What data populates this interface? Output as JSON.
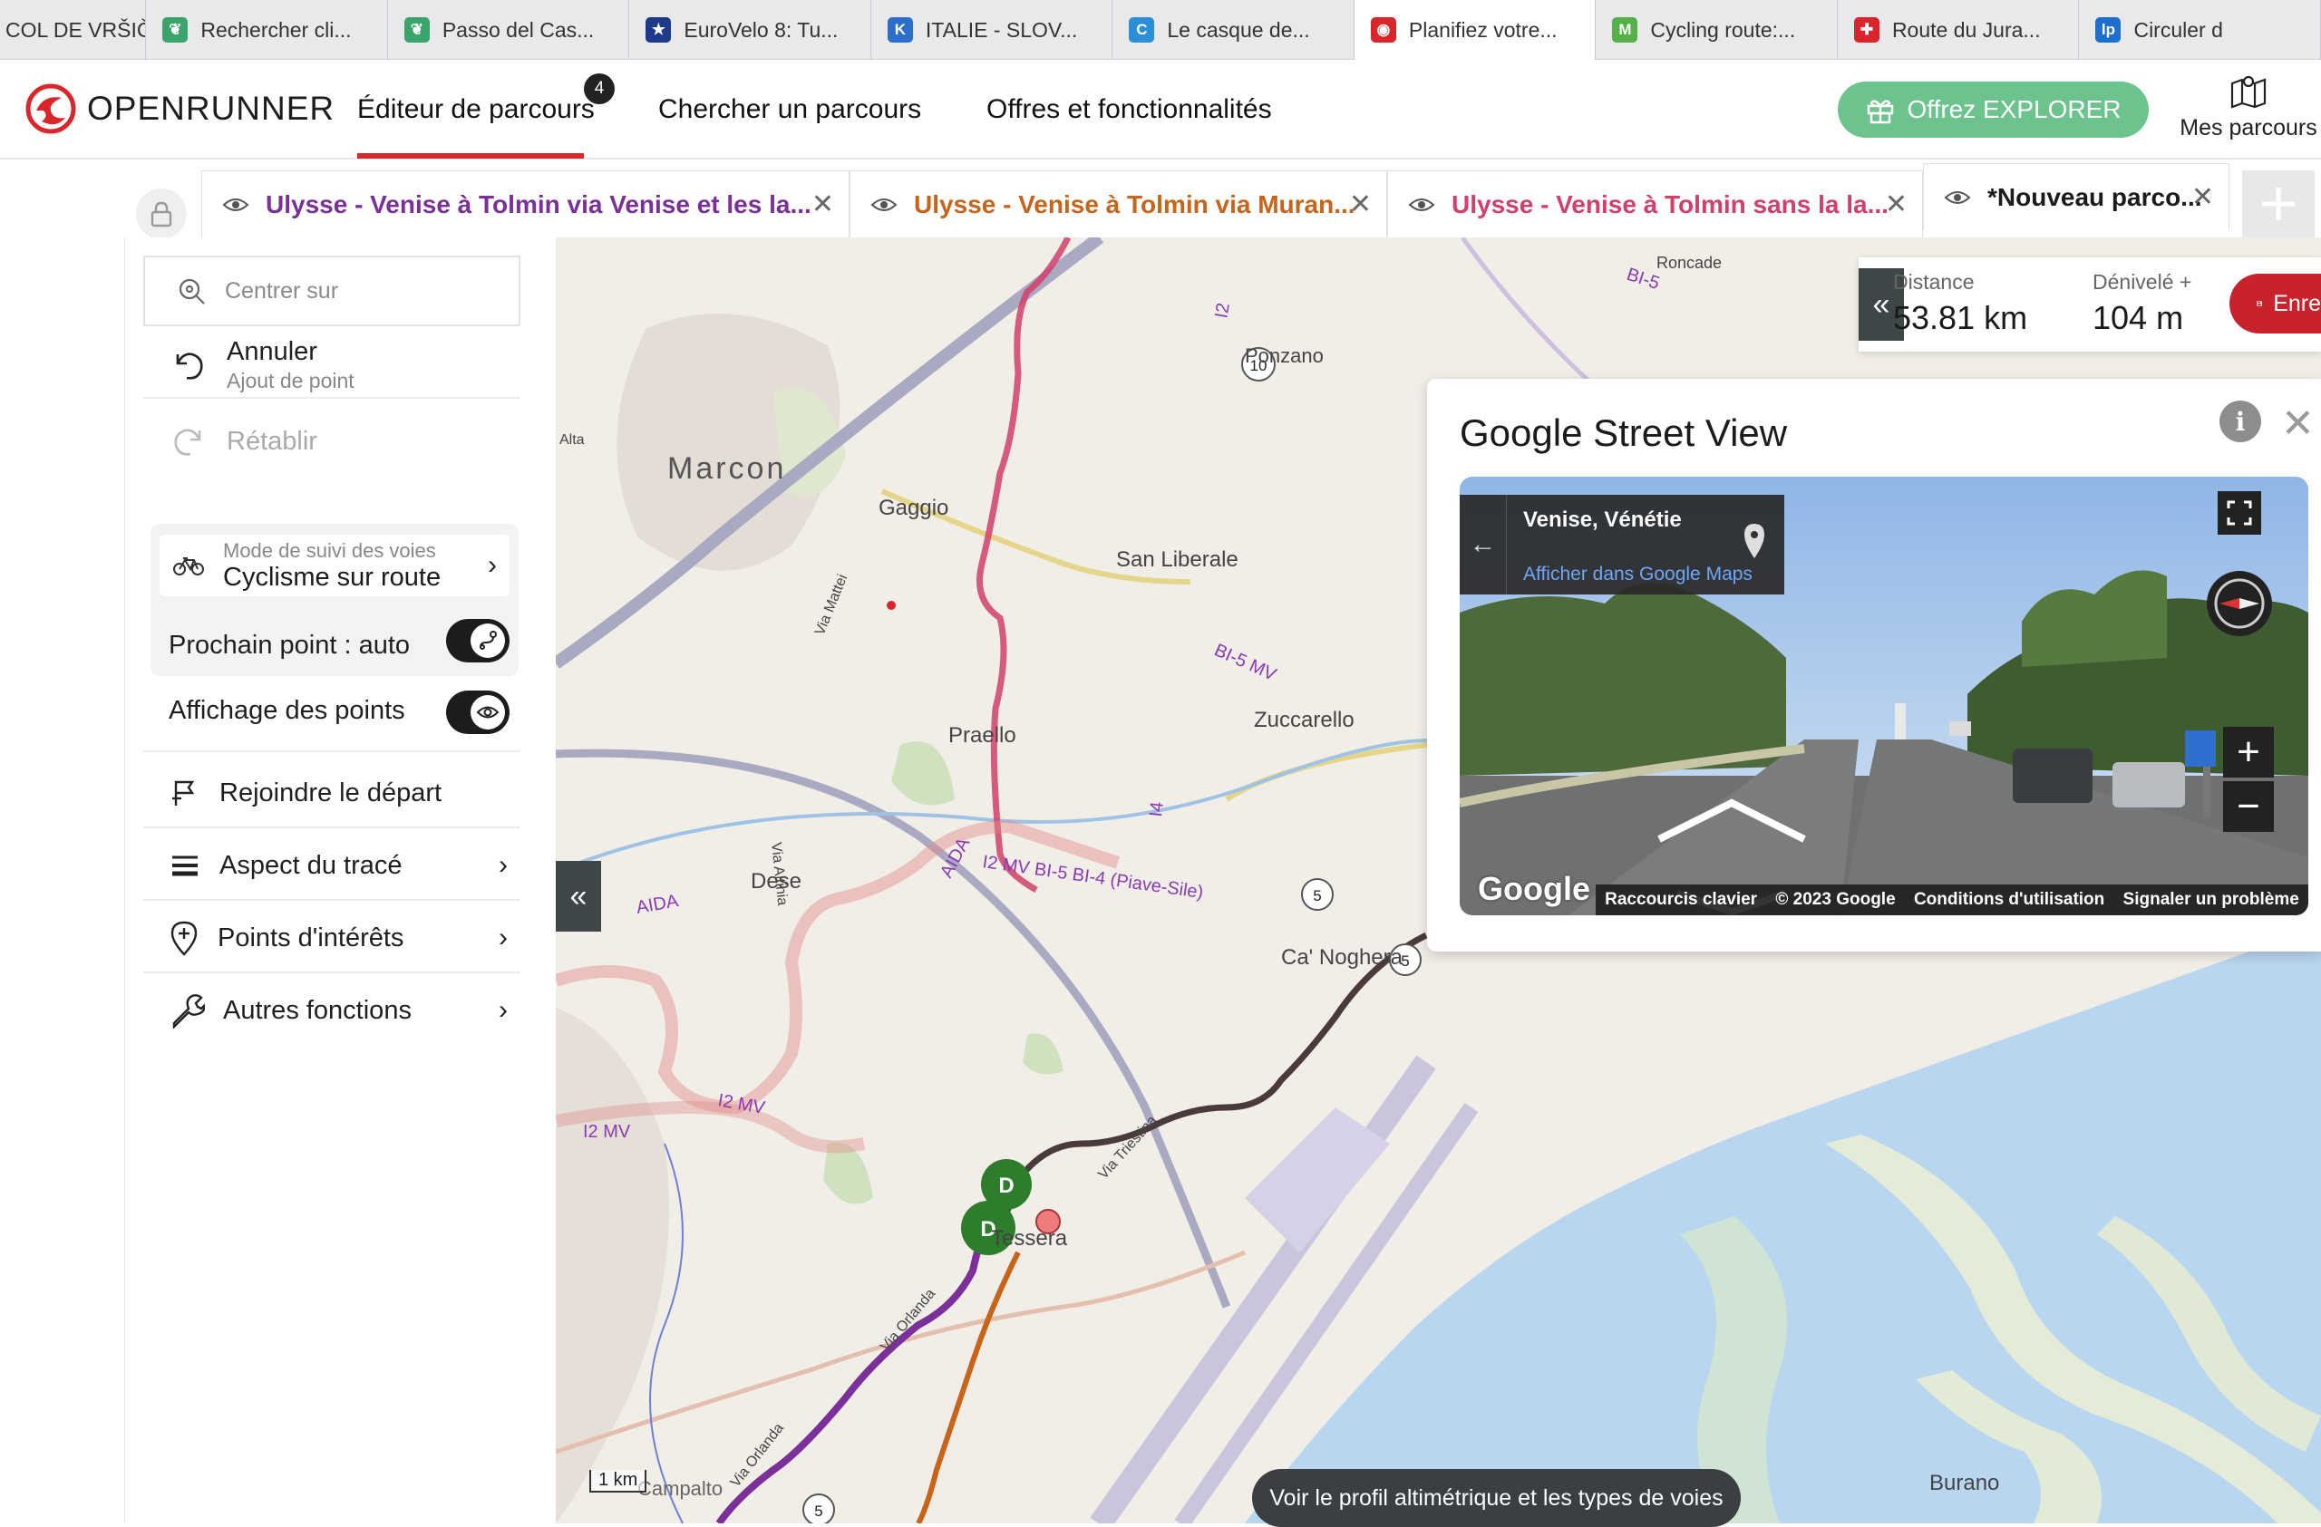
{
  "browser_tabs": [
    {
      "title": "COL DE VRŠIČ...",
      "icon": "none",
      "color": "#ffffff"
    },
    {
      "title": "Rechercher cli...",
      "icon": "leaf-icon",
      "color": "#3aa56a"
    },
    {
      "title": "Passo del Cas...",
      "icon": "leaf-icon",
      "color": "#3aa56a"
    },
    {
      "title": "EuroVelo 8: Tu...",
      "icon": "eurovelo-icon",
      "color": "#1e3a8a"
    },
    {
      "title": "ITALIE - SLOV...",
      "icon": "k-icon",
      "color": "#2a6fc9"
    },
    {
      "title": "Le casque de...",
      "icon": "c-icon",
      "color": "#2a8fd6"
    },
    {
      "title": "Planifiez votre...",
      "icon": "openrunner-icon",
      "color": "#d8262b",
      "active": true
    },
    {
      "title": "Cycling route:...",
      "icon": "m-icon",
      "color": "#55b048"
    },
    {
      "title": "Route du Jura...",
      "icon": "swiss-icon",
      "color": "#d9252c"
    },
    {
      "title": "Circuler d",
      "icon": "lp-icon",
      "color": "#1c6fcf"
    }
  ],
  "header": {
    "logo_text": "OPENRUNNER",
    "nav": {
      "editor": "Éditeur de parcours",
      "editor_badge": "4",
      "search": "Chercher un parcours",
      "offers": "Offres et fonctionnalités"
    },
    "explorer_label": "Offrez EXPLORER",
    "my_routes_label": "Mes parcours"
  },
  "route_tabs": [
    {
      "title": "Ulysse - Venise à Tolmin via Venise et les la...",
      "color": "#7b2f98"
    },
    {
      "title": "Ulysse - Venise à Tolmin via Muran...",
      "color": "#c8631a"
    },
    {
      "title": "Ulysse - Venise à Tolmin sans la la...",
      "color": "#d1406a"
    },
    {
      "title": "*Nouveau parco...",
      "color": "#1b1b1b"
    }
  ],
  "left_panel": {
    "center_placeholder": "Centrer sur",
    "undo_label": "Annuler",
    "undo_sub": "Ajout de point",
    "redo_label": "Rétablir",
    "mode_label": "Mode de suivi des voies",
    "mode_value": "Cyclisme sur route",
    "next_point_label": "Prochain point : auto",
    "show_points_label": "Affichage des points",
    "rejoin_label": "Rejoindre le départ",
    "trace_label": "Aspect du tracé",
    "poi_label": "Points d'intérêts",
    "other_label": "Autres fonctions"
  },
  "stats": {
    "distance_label": "Distance",
    "distance_value": "53.81 km",
    "elevation_label": "Dénivelé +",
    "elevation_value": "104 m",
    "save_label": "Enre"
  },
  "street_view": {
    "title": "Google Street View",
    "place": "Venise, Vénétie",
    "maps_link": "Afficher dans Google Maps",
    "google_logo": "Google",
    "footer": [
      "Raccourcis clavier",
      "© 2023 Google",
      "Conditions d'utilisation",
      "Signaler un problème"
    ]
  },
  "map": {
    "labels": {
      "marcon": "Marcon",
      "gaggio": "Gaggio",
      "san_liberale": "San Liberale",
      "zuccarello": "Zuccarello",
      "praello": "Praello",
      "dese": "Dese",
      "ca_noghera": "Ca' Noghera",
      "tessera": "Tessera",
      "burano": "Burano",
      "campalto": "Campalto",
      "alta": "Alta",
      "via_mattei": "Via Mattei",
      "via_triestina": "Via Triestina",
      "via_orlanda": "Via Orlanda",
      "via_altinia": "Via Altinia",
      "piave_sile": "I2 MV  BI-5  BI-4 (Piave-Sile)",
      "bi5_mv": "BI-5 MV",
      "i2_mv": "I2 MV",
      "aida": "AIDA",
      "i4": "I4",
      "ponzano": "Ponzano",
      "roncade": "Roncade",
      "bi5": "BI-5",
      "i2": "I2"
    },
    "markers": {
      "start_1": "D",
      "start_2": "D",
      "road_10": "10",
      "road_5a": "5",
      "road_5b": "5",
      "road_5c": "5"
    },
    "scale_label": "1 km"
  },
  "profile_button": "Voir le profil altimétrique et les types de voies",
  "colors": {
    "brand_red": "#d8262b",
    "explorer_green": "#6cc38d",
    "route_purple": "#7b2f98",
    "route_orange": "#c8631a",
    "route_pink": "#d1406a",
    "route_dark": "#4a3a3c",
    "water": "#b9d6f0",
    "land": "#f1eee8"
  }
}
